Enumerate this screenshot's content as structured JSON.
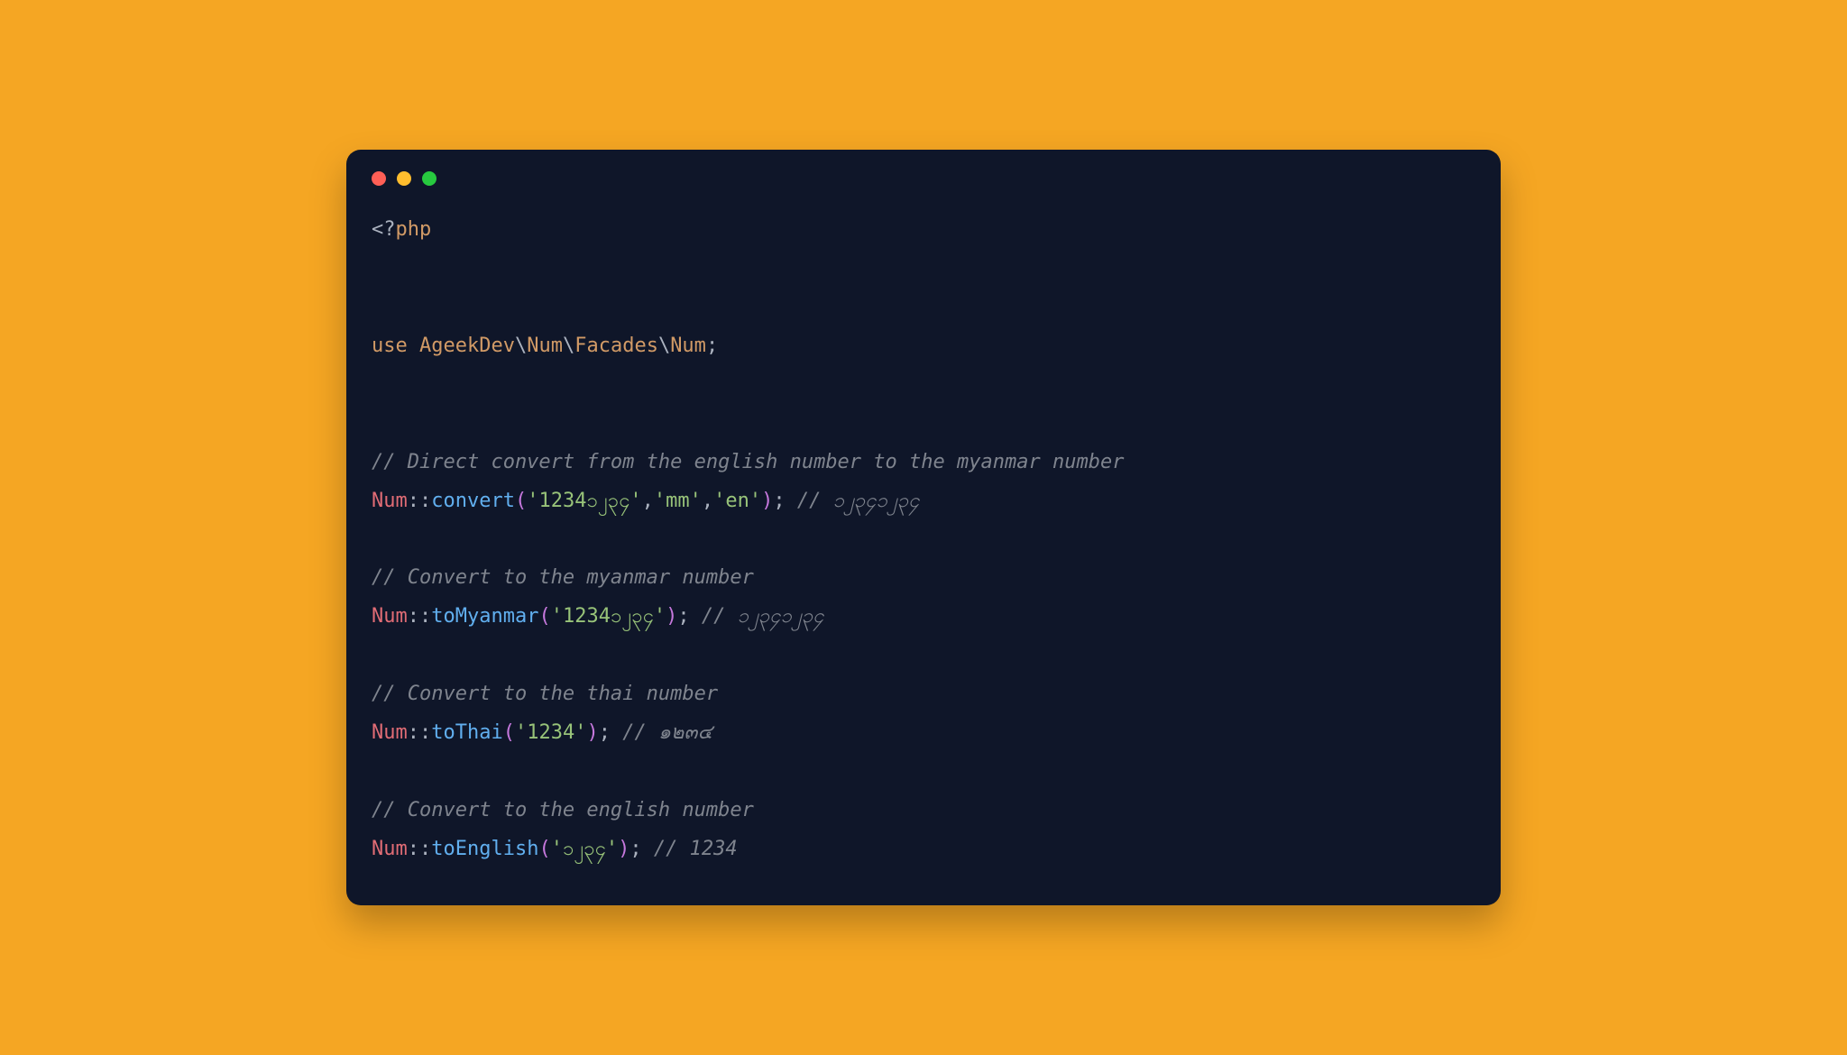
{
  "titlebar": {
    "red": "close",
    "yellow": "minimize",
    "green": "maximize"
  },
  "code": {
    "phpOpen": {
      "lt": "<?",
      "tag": "php"
    },
    "useStatement": {
      "use": "use",
      "space1": " ",
      "ns1": "AgeekDev",
      "bs1": "\\",
      "ns2": "Num",
      "bs2": "\\",
      "ns3": "Facades",
      "bs3": "\\",
      "cls": "Num",
      "semi": ";"
    },
    "comment1": "// Direct convert from the english number to the myanmar number",
    "line1": {
      "cls": "Num",
      "scope": "::",
      "method": "convert",
      "p1": "(",
      "arg1": "'1234၁၂၃၄'",
      "comma1": ",",
      "arg2": "'mm'",
      "comma2": ",",
      "arg3": "'en'",
      "p2": ")",
      "semi": ";",
      "space": " ",
      "comment": "// ၁၂၃၄၁၂၃၄"
    },
    "comment2": "// Convert to the myanmar number",
    "line2": {
      "cls": "Num",
      "scope": "::",
      "method": "toMyanmar",
      "p1": "(",
      "arg1": "'1234၁၂၃၄'",
      "p2": ")",
      "semi": ";",
      "space": " ",
      "comment": "// ၁၂၃၄၁၂၃၄"
    },
    "comment3": "// Convert to the thai number",
    "line3": {
      "cls": "Num",
      "scope": "::",
      "method": "toThai",
      "p1": "(",
      "arg1": "'1234'",
      "p2": ")",
      "semi": ";",
      "space": " ",
      "comment": "// ๑๒๓๔"
    },
    "comment4": "// Convert to the english number",
    "line4": {
      "cls": "Num",
      "scope": "::",
      "method": "toEnglish",
      "p1": "(",
      "arg1": "'၁၂၃၄'",
      "p2": ")",
      "semi": ";",
      "space": " ",
      "comment": "// 1234"
    }
  }
}
